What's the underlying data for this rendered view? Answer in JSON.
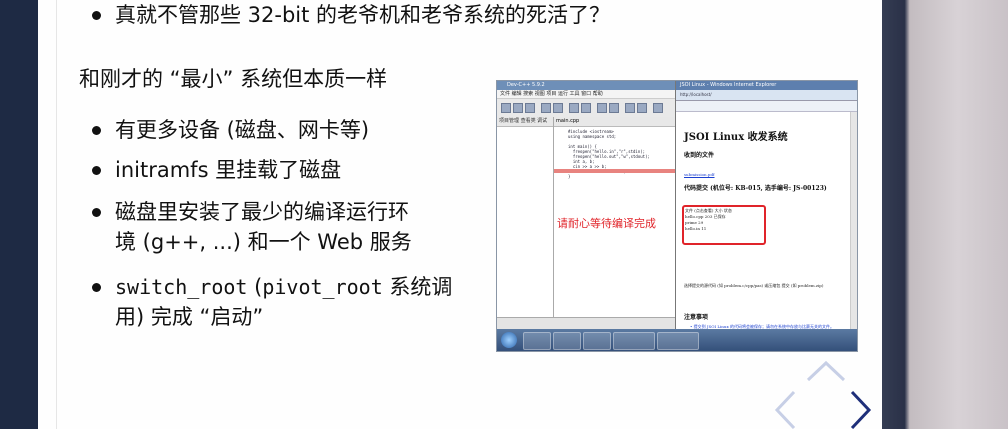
{
  "slide": {
    "top_bullet": "真就不管那些 32-bit 的老爷机和老爷系统的死活了？",
    "heading": "和刚才的 “最小” 系统但本质一样",
    "bullets": {
      "b1": "有更多设备 (磁盘、网卡等)",
      "b2": "initramfs 里挂载了磁盘",
      "b3_line1": "磁盘里安装了最少的编译运行环",
      "b3_line2": "境 (g++, ...) 和一个 Web 服务",
      "b4_code": "switch_root",
      "b4_mid": " (",
      "b4_code2": "pivot_root",
      "b4_rest": " 系统调",
      "b4_line2": "用) 完成 “启动”"
    }
  },
  "screenshot": {
    "ide_title": "Dev-C++ 5.9.2",
    "ide_menu": "文件 编辑 搜索 视图 项目 运行 工具 窗口 帮助",
    "ide_tab": "main.cpp",
    "ide_left_tab": "项目管理 查看类 调试",
    "code": "#include <iostream>\nusing namespace std;\n\nint main() {\n  freopen(\"hello.in\",\"r\",stdin);\n  freopen(\"hello.out\",\"w\",stdout);\n  int a, b;\n  cin >> a >> b;\n  cout << a + b << endl;\n}",
    "wait_text": "请耐心等待编译完成",
    "ie_title": "JSOI Linux - Windows Internet Explorer",
    "ie_addr": "http://localhost/",
    "page_title": "JSOI Linux 收发系统",
    "received": "收到的文件",
    "file_link": "submission.pdf",
    "code_submit": "代码提交 (机位号: KB-015, 选手编号: JS-00123)",
    "table_rows": [
      "文件  (点击查看) 大小  状态",
      "hello.cpp     203   已保存",
      "prime          29",
      "hello.in       11"
    ],
    "choose": "选择提交的源代码 (如 problem.c/cpp/pas) 或压缩包 提交 (如 problem.zip)",
    "notes_title": "注意事项",
    "notes_body": "• 提交到 JSOI Linux 的代码将会被保存；请勿在系统中存放与比赛无关的文件。"
  }
}
